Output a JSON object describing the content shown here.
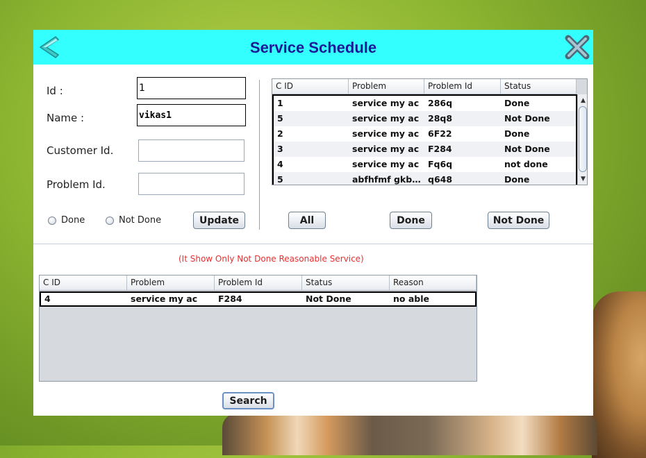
{
  "window": {
    "title": "Service Schedule"
  },
  "form": {
    "id_label": "Id :",
    "id_value": "1",
    "name_label": "Name :",
    "name_value": "vikas1",
    "customer_label": "Customer Id.",
    "customer_value": "",
    "problem_label": "Problem Id.",
    "problem_value": "",
    "radio_done": "Done",
    "radio_not_done": "Not Done",
    "update_button": "Update"
  },
  "top_table": {
    "columns": [
      "C ID",
      "Problem",
      "Problem Id",
      "Status"
    ],
    "rows": [
      [
        "1",
        "service my ac",
        "286q",
        "Done"
      ],
      [
        "5",
        "service my ac",
        "28q8",
        "Not Done"
      ],
      [
        "2",
        "service my ac",
        "6F22",
        "Done"
      ],
      [
        "3",
        "service my ac",
        "F284",
        "Not Done"
      ],
      [
        "4",
        "service my ac",
        "Fq6q",
        "not done"
      ],
      [
        "5",
        "abfhfmf gkbjg ...",
        "q648",
        "Done"
      ]
    ]
  },
  "filters": {
    "all": "All",
    "done": "Done",
    "not_done": "Not Done"
  },
  "note": "(It Show Only Not Done  Reasonable Service)",
  "bottom_table": {
    "columns": [
      "C ID",
      "Problem",
      "Problem Id",
      "Status",
      "Reason"
    ],
    "rows": [
      [
        "4",
        "service my ac",
        "F284",
        "Not Done",
        "no able"
      ]
    ]
  },
  "search_button": "Search",
  "icons": {
    "back": "back-arrow-icon",
    "close": "close-x-icon"
  },
  "colors": {
    "titlebar": "#33ffff",
    "title_text": "#1a1a99",
    "note_text": "#e53030"
  }
}
